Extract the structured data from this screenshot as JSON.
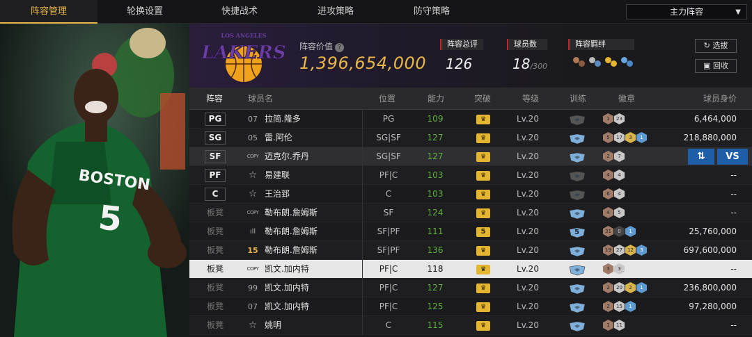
{
  "tabs": [
    "阵容管理",
    "轮换设置",
    "快捷战术",
    "进攻策略",
    "防守策略"
  ],
  "dropdown": {
    "selected": "主力阵容"
  },
  "header": {
    "value_label": "阵容价值",
    "value": "1,396,654,000",
    "rating_label": "阵容总评",
    "rating": "126",
    "players_label": "球员数",
    "players": "18",
    "players_max": "/300",
    "bonds_label": "阵容羁绊",
    "pick_label": "选拔",
    "recycle_label": "回收",
    "logo_top": "LOS ANGELES",
    "logo_main": "LAKERS"
  },
  "table_headers": [
    "阵容",
    "球员名",
    "位置",
    "能力",
    "突破",
    "等级",
    "训练",
    "徽章",
    "球员身价"
  ],
  "swap_icon": "swap-icon",
  "vs_label": "VS",
  "rows": [
    {
      "slot": "PG",
      "is_pos": true,
      "jersey": "07",
      "jersey_style": "num",
      "name": "拉简.隆多",
      "position": "PG",
      "ability": "109",
      "breakthrough": "crown",
      "level": "Lv.20",
      "train": "dark",
      "badges": [
        [
          "b",
          "1"
        ],
        [
          "s",
          "23"
        ]
      ],
      "price": "6,464,000"
    },
    {
      "slot": "SG",
      "is_pos": true,
      "jersey": "05",
      "jersey_style": "num",
      "name": "雷.阿伦",
      "position": "SG|SF",
      "ability": "127",
      "breakthrough": "crown",
      "level": "Lv.20",
      "train": "blue",
      "badges": [
        [
          "b",
          "5"
        ],
        [
          "s",
          "17"
        ],
        [
          "g",
          "3"
        ],
        [
          "p",
          "1"
        ]
      ],
      "price": "218,880,000"
    },
    {
      "slot": "SF",
      "is_pos": true,
      "jersey": "COPY",
      "jersey_style": "copy",
      "name": "迈克尔.乔丹",
      "position": "SG|SF",
      "ability": "127",
      "breakthrough": "crown",
      "level": "Lv.20",
      "train": "blue",
      "badges": [
        [
          "b",
          "2"
        ],
        [
          "s",
          "7"
        ]
      ],
      "price": "",
      "selected": true
    },
    {
      "slot": "PF",
      "is_pos": true,
      "jersey": "☆",
      "jersey_style": "star",
      "name": "易建联",
      "position": "PF|C",
      "ability": "103",
      "breakthrough": "crown",
      "level": "Lv.20",
      "train": "dark",
      "badges": [
        [
          "b",
          "4"
        ],
        [
          "s",
          "4"
        ]
      ],
      "price": "--"
    },
    {
      "slot": "C",
      "is_pos": true,
      "jersey": "☆",
      "jersey_style": "star",
      "name": "王治郅",
      "position": "C",
      "ability": "103",
      "breakthrough": "crown",
      "level": "Lv.20",
      "train": "dark",
      "badges": [
        [
          "b",
          "6"
        ],
        [
          "s",
          "4"
        ]
      ],
      "price": "--"
    },
    {
      "slot": "板凳",
      "is_pos": false,
      "jersey": "COPY",
      "jersey_style": "copy",
      "name": "勒布朗.詹姆斯",
      "position": "SF",
      "ability": "124",
      "breakthrough": "crown",
      "level": "Lv.20",
      "train": "blue",
      "badges": [
        [
          "b",
          "4"
        ],
        [
          "s",
          "5"
        ]
      ],
      "price": "--"
    },
    {
      "slot": "板凳",
      "is_pos": false,
      "jersey": "ıll",
      "jersey_style": "bars",
      "name": "勒布朗.詹姆斯",
      "position": "SF|PF",
      "ability": "111",
      "breakthrough": "5",
      "level": "Lv.20",
      "train": "blue5",
      "badges": [
        [
          "b",
          "31"
        ],
        [
          "d",
          "0"
        ],
        [
          "p",
          "1"
        ]
      ],
      "price": "25,760,000"
    },
    {
      "slot": "板凳",
      "is_pos": false,
      "jersey": "15",
      "jersey_style": "gold",
      "name": "勒布朗.詹姆斯",
      "position": "SF|PF",
      "ability": "136",
      "breakthrough": "crown",
      "level": "Lv.20",
      "train": "blue",
      "badges": [
        [
          "b",
          "19"
        ],
        [
          "s",
          "27"
        ],
        [
          "g",
          "12"
        ],
        [
          "p",
          "3"
        ]
      ],
      "price": "697,600,000"
    },
    {
      "slot": "板凳",
      "is_pos": false,
      "jersey": "COPY",
      "jersey_style": "copy",
      "name": "凯文.加内特",
      "position": "PF|C",
      "ability": "118",
      "breakthrough": "crown",
      "level": "Lv.20",
      "train": "blue",
      "badges": [
        [
          "b",
          "3"
        ],
        [
          "s",
          "3"
        ]
      ],
      "price": "--",
      "highlight": true
    },
    {
      "slot": "板凳",
      "is_pos": false,
      "jersey": "99",
      "jersey_style": "num",
      "name": "凯文.加内特",
      "position": "PF|C",
      "ability": "127",
      "breakthrough": "crown",
      "level": "Lv.20",
      "train": "blue",
      "badges": [
        [
          "b",
          "2"
        ],
        [
          "s",
          "20"
        ],
        [
          "g",
          "2"
        ],
        [
          "p",
          "1"
        ]
      ],
      "price": "236,800,000"
    },
    {
      "slot": "板凳",
      "is_pos": false,
      "jersey": "07",
      "jersey_style": "num",
      "name": "凯文.加内特",
      "position": "PF|C",
      "ability": "125",
      "breakthrough": "crown",
      "level": "Lv.20",
      "train": "blue",
      "badges": [
        [
          "b",
          "2"
        ],
        [
          "s",
          "15"
        ],
        [
          "p",
          "1"
        ]
      ],
      "price": "97,280,000"
    },
    {
      "slot": "板凳",
      "is_pos": false,
      "jersey": "☆",
      "jersey_style": "star",
      "name": "姚明",
      "position": "C",
      "ability": "115",
      "breakthrough": "crown",
      "level": "Lv.20",
      "train": "blue",
      "badges": [
        [
          "b",
          "1"
        ],
        [
          "s",
          "11"
        ]
      ],
      "price": "--"
    }
  ],
  "player_art": {
    "jersey_text": "BOSTON",
    "jersey_number": "5"
  },
  "colors": {
    "accent": "#e8b64a",
    "ability": "#5fb13e",
    "button": "#1e5da8",
    "breakthrough": "#e3b530"
  }
}
